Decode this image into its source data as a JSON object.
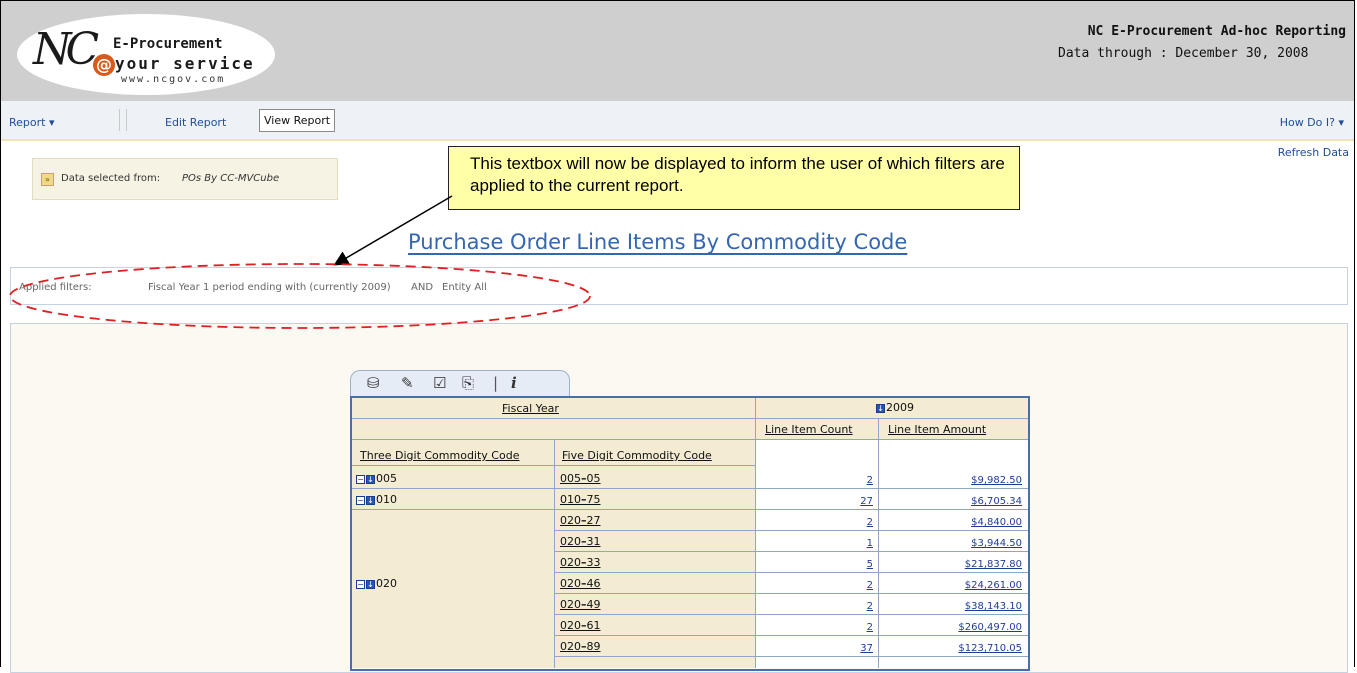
{
  "logo": {
    "nc": "NC",
    "at": "@",
    "line1": "E-Procurement",
    "line2": "your service",
    "line3": "www.ncgov.com"
  },
  "header": {
    "title": "NC E-Procurement Ad-hoc Reporting",
    "data_through": "Data through : December 30, 2008"
  },
  "toolbar": {
    "report": "Report",
    "edit_report": "Edit Report",
    "view_report": "View Report",
    "how_do_i": "How Do I?"
  },
  "refresh": "Refresh Data",
  "data_selected": {
    "label": "Data selected from:",
    "value": "POs By CC-MVCube"
  },
  "callout": {
    "text": "This textbox will now be displayed to inform the user of which filters are applied to the current report."
  },
  "report_title": "Purchase Order Line Items By Commodity Code",
  "filters": {
    "label": "Applied filters:",
    "f1": "Fiscal Year 1 period ending with (currently 2009)",
    "and": "AND",
    "f2": "Entity All"
  },
  "pivot": {
    "fiscal_year_header": "Fiscal Year",
    "year": "2009",
    "col_count": "Line Item Count",
    "col_amount": "Line Item Amount",
    "col_three": "Three Digit Commodity Code",
    "col_five": "Five Digit Commodity Code",
    "rows": [
      {
        "three": "005",
        "five_a": "005",
        "five_b": "05",
        "count": "2",
        "amount": "$9,982.50"
      },
      {
        "three": "010",
        "five_a": "010",
        "five_b": "75",
        "count": "27",
        "amount": "$6,705.34"
      },
      {
        "three": "",
        "five_a": "020",
        "five_b": "27",
        "count": "2",
        "amount": "$4,840.00"
      },
      {
        "three": "",
        "five_a": "020",
        "five_b": "31",
        "count": "1",
        "amount": "$3,944.50"
      },
      {
        "three": "",
        "five_a": "020",
        "five_b": "33",
        "count": "5",
        "amount": "$21,837.80"
      },
      {
        "three": "020",
        "five_a": "020",
        "five_b": "46",
        "count": "2",
        "amount": "$24,261.00"
      },
      {
        "three": "",
        "five_a": "020",
        "five_b": "49",
        "count": "2",
        "amount": "$38,143.10"
      },
      {
        "three": "",
        "five_a": "020",
        "five_b": "61",
        "count": "2",
        "amount": "$260,497.00"
      },
      {
        "three": "",
        "five_a": "020",
        "five_b": "89",
        "count": "37",
        "amount": "$123,710.05"
      }
    ]
  },
  "colors": {
    "link": "#1f3c99",
    "title": "#3567b0",
    "callout_bg": "#ffffa8",
    "ellipse": "#e02020"
  }
}
